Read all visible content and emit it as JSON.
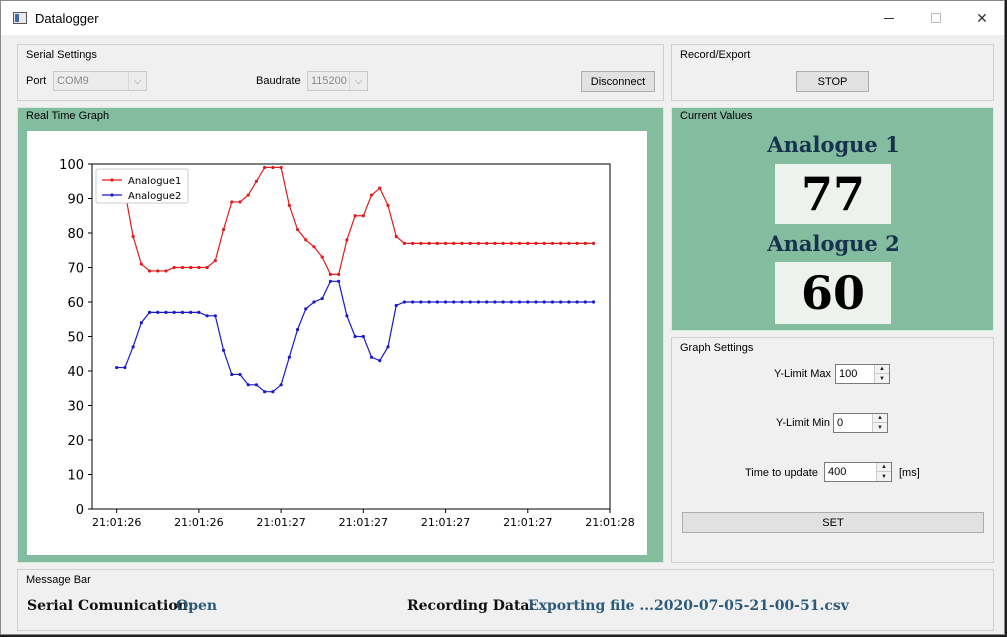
{
  "window": {
    "title": "Datalogger"
  },
  "serial_settings": {
    "title": "Serial Settings",
    "port_label": "Port",
    "port_value": "COM9",
    "baud_label": "Baudrate",
    "baud_value": "115200",
    "disconnect_label": "Disconnect"
  },
  "record_export": {
    "title": "Record/Export",
    "stop_label": "STOP"
  },
  "graph": {
    "title": "Real Time Graph"
  },
  "current_values": {
    "title": "Current Values",
    "a1_label": "Analogue 1",
    "a1_value": "77",
    "a2_label": "Analogue 2",
    "a2_value": "60"
  },
  "graph_settings": {
    "title": "Graph Settings",
    "ymax_label": "Y-Limit Max",
    "ymax_value": "100",
    "ymin_label": "Y-Limit Min",
    "ymin_value": "0",
    "update_label": "Time to update",
    "update_value": "400",
    "update_unit": "[ms]",
    "set_label": "SET"
  },
  "message_bar": {
    "title": "Message Bar",
    "serial_label": "Serial Comunication:",
    "serial_value": "Open",
    "recording_label": "Recording Data:",
    "recording_value": "Exporting file ...2020-07-05-21-00-51.csv"
  },
  "chart_data": {
    "type": "line",
    "ylim": [
      0,
      100
    ],
    "yticks": [
      0,
      10,
      20,
      30,
      40,
      50,
      60,
      70,
      80,
      90,
      100
    ],
    "xlim": [
      -3,
      60
    ],
    "xtick_positions": [
      0,
      10,
      20,
      30,
      40,
      50,
      60
    ],
    "xtick_labels": [
      "21:01:26",
      "21:01:26",
      "21:01:27",
      "21:01:27",
      "21:01:27",
      "21:01:27",
      "21:01:28"
    ],
    "legend_position": "top-left",
    "grid": false,
    "series": [
      {
        "name": "Analogue1",
        "color": "#e31a1c",
        "values": [
          93,
          92,
          79,
          71,
          69,
          69,
          69,
          70,
          70,
          70,
          70,
          70,
          72,
          81,
          89,
          89,
          91,
          95,
          99,
          99,
          99,
          88,
          81,
          78,
          76,
          73,
          68,
          68,
          78,
          85,
          85,
          91,
          93,
          88,
          79,
          77,
          77,
          77,
          77,
          77,
          77,
          77,
          77,
          77,
          77,
          77,
          77,
          77,
          77,
          77,
          77,
          77,
          77,
          77,
          77,
          77,
          77,
          77,
          77
        ]
      },
      {
        "name": "Analogue2",
        "color": "#1a1ac8",
        "values": [
          41,
          41,
          47,
          54,
          57,
          57,
          57,
          57,
          57,
          57,
          57,
          56,
          56,
          46,
          39,
          39,
          36,
          36,
          34,
          34,
          36,
          44,
          52,
          58,
          60,
          61,
          66,
          66,
          56,
          50,
          50,
          44,
          43,
          47,
          59,
          60,
          60,
          60,
          60,
          60,
          60,
          60,
          60,
          60,
          60,
          60,
          60,
          60,
          60,
          60,
          60,
          60,
          60,
          60,
          60,
          60,
          60,
          60,
          60
        ]
      }
    ]
  }
}
